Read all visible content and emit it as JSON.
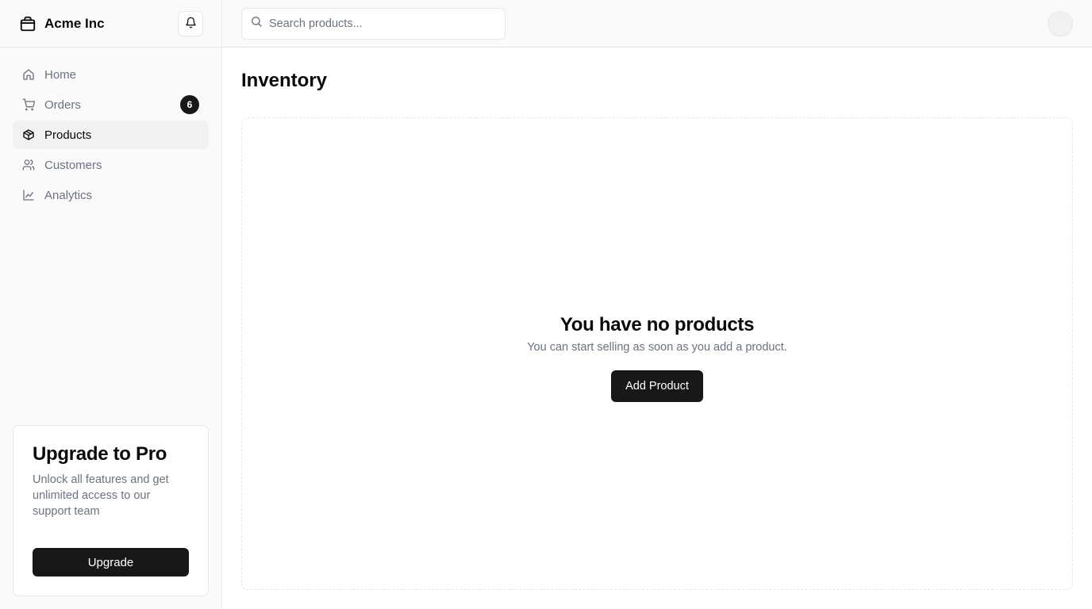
{
  "sidebar": {
    "brand": {
      "name": "Acme Inc",
      "icon": "package-icon"
    },
    "notifications_icon": "bell-icon",
    "items": [
      {
        "label": "Home",
        "icon": "home-icon",
        "active": false
      },
      {
        "label": "Orders",
        "icon": "cart-icon",
        "active": false,
        "badge": "6"
      },
      {
        "label": "Products",
        "icon": "box-icon",
        "active": true
      },
      {
        "label": "Customers",
        "icon": "users-icon",
        "active": false
      },
      {
        "label": "Analytics",
        "icon": "chart-line-icon",
        "active": false
      }
    ],
    "upgrade": {
      "title": "Upgrade to Pro",
      "description": "Unlock all features and get unlimited access to our support team",
      "button": "Upgrade"
    }
  },
  "topbar": {
    "search": {
      "placeholder": "Search products...",
      "value": "",
      "icon": "search-icon"
    },
    "avatar_icon": "avatar"
  },
  "main": {
    "title": "Inventory",
    "empty_state": {
      "title": "You have no products",
      "description": "You can start selling as soon as you add a product.",
      "button": "Add Product"
    }
  },
  "colors": {
    "primary": "#18181b",
    "muted_text": "#6b7280",
    "border": "#e5e7eb",
    "sidebar_bg": "#fafafa",
    "active_bg": "#f0f1f3"
  }
}
